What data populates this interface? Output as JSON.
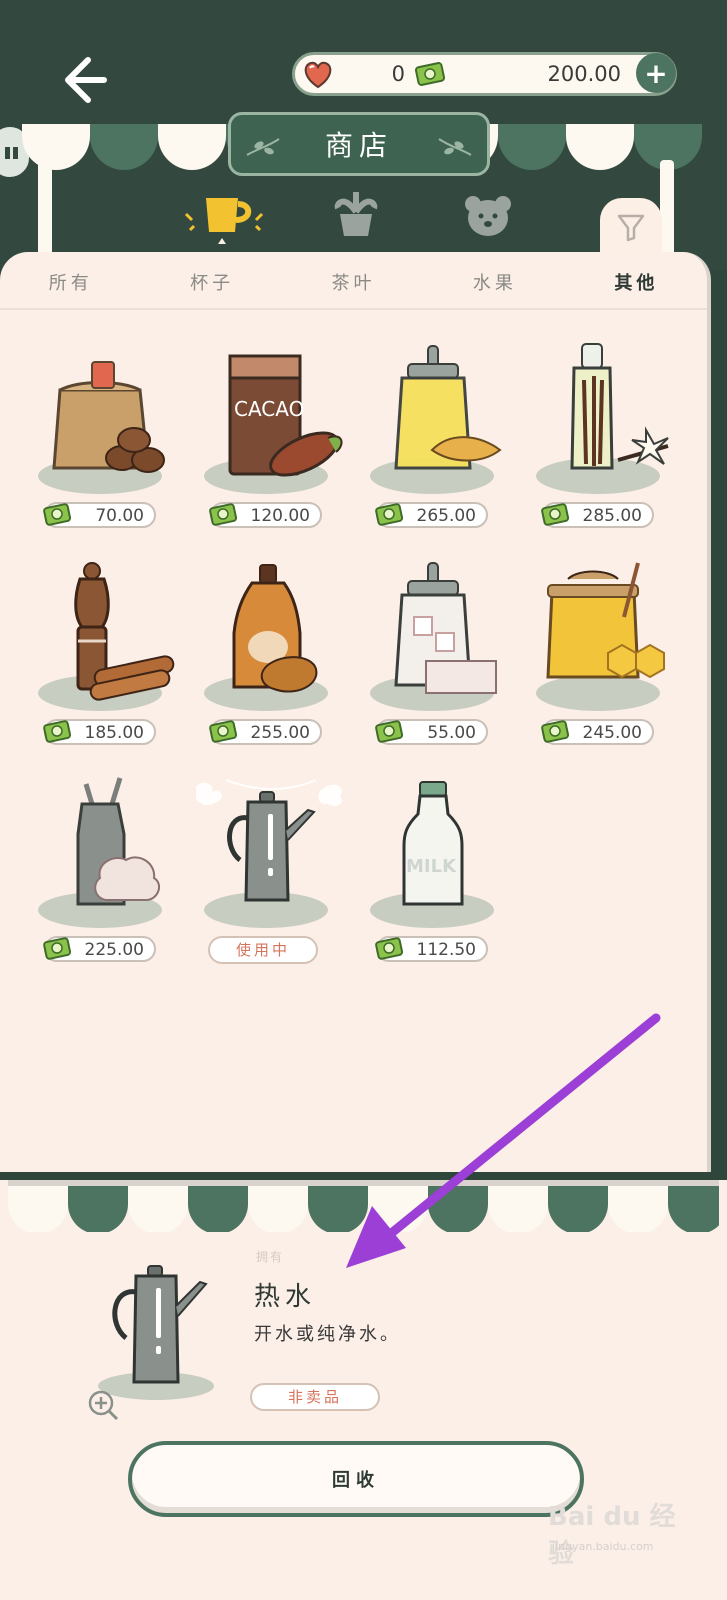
{
  "header": {
    "hearts": "0",
    "cash": "200.00",
    "shop_title": "商店"
  },
  "tabs": [
    {
      "label": "所有"
    },
    {
      "label": "杯子"
    },
    {
      "label": "茶叶"
    },
    {
      "label": "水果"
    },
    {
      "label": "其他"
    }
  ],
  "active_tab": "其他",
  "items": [
    {
      "name": "coffee-beans",
      "price": "70.00"
    },
    {
      "name": "cacao",
      "price": "120.00"
    },
    {
      "name": "ginger-jar",
      "price": "265.00"
    },
    {
      "name": "vanilla-bottle",
      "price": "285.00"
    },
    {
      "name": "cinnamon-pepper",
      "price": "185.00"
    },
    {
      "name": "maple-syrup",
      "price": "255.00"
    },
    {
      "name": "sugar-cubes",
      "price": "55.00"
    },
    {
      "name": "honey-jar",
      "price": "245.00"
    },
    {
      "name": "whipped-cream",
      "price": "225.00"
    },
    {
      "name": "hot-water-kettle",
      "status": "使用中"
    },
    {
      "name": "milk-bottle",
      "price": "112.50"
    }
  ],
  "detail": {
    "tag": "拥有",
    "name": "热水",
    "description": "开水或纯净水。",
    "badge": "非卖品",
    "action": "回收"
  },
  "watermark": {
    "brand": "Bai du 经验",
    "url": "jingyan.baidu.com"
  },
  "colors": {
    "header_bg": "#33493f",
    "accent_green": "#4c7461",
    "panel_bg": "#fcefe8",
    "status_red": "#d4745c",
    "arrow": "#9b3fd6"
  }
}
